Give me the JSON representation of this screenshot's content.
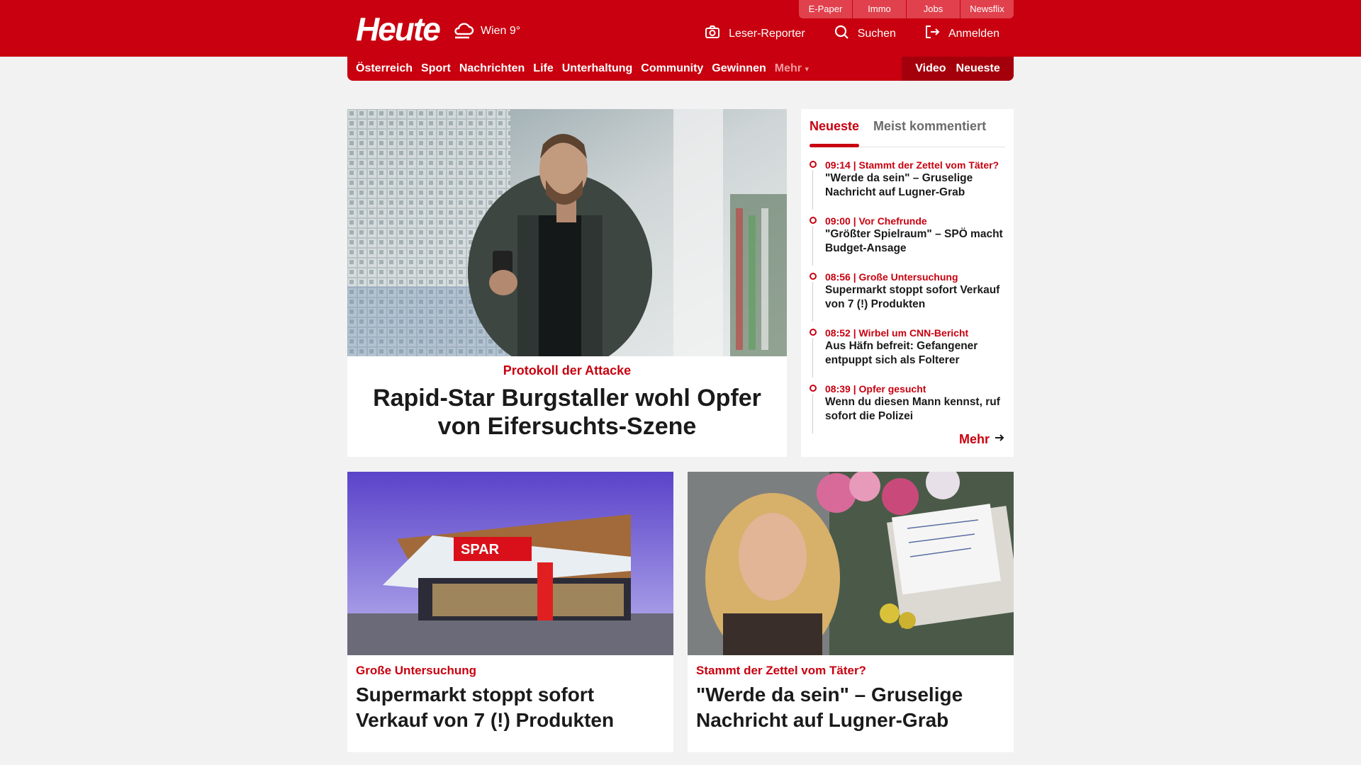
{
  "header": {
    "logo": "Heute",
    "weather": "Wien 9°",
    "service_links": [
      "E-Paper",
      "Immo",
      "Jobs",
      "Newsflix"
    ],
    "actions": {
      "reporter": "Leser-Reporter",
      "search": "Suchen",
      "login": "Anmelden"
    }
  },
  "nav": {
    "items": [
      "Österreich",
      "Sport",
      "Nachrichten",
      "Life",
      "Unterhaltung",
      "Community",
      "Gewinnen"
    ],
    "more": "Mehr",
    "video": "Video",
    "latest": "Neueste"
  },
  "hero": {
    "kicker": "Protokoll der Attacke",
    "title": "Rapid-Star Burgstaller wohl Opfer von Eifersuchts-Szene"
  },
  "sidebar": {
    "tabs": [
      "Neueste",
      "Meist kommentiert"
    ],
    "items": [
      {
        "meta": "09:14 | Stammt der Zettel vom Täter?",
        "title": "\"Werde da sein\" – Gruselige Nachricht auf Lugner-Grab"
      },
      {
        "meta": "09:00 | Vor Chefrunde",
        "title": "\"Größter Spielraum\" – SPÖ macht Budget-Ansage"
      },
      {
        "meta": "08:56 | Große Untersuchung",
        "title": "Supermarkt stoppt sofort Verkauf von 7 (!) Produkten"
      },
      {
        "meta": "08:52 | Wirbel um CNN-Bericht",
        "title": "Aus Häfn befreit: Gefangener entpuppt sich als Folterer"
      },
      {
        "meta": "08:39 | Opfer gesucht",
        "title": "Wenn du diesen Mann kennst, ruf sofort die Polizei"
      }
    ],
    "more": "Mehr"
  },
  "cards": [
    {
      "kicker": "Große Untersuchung",
      "title": "Supermarkt stoppt sofort Verkauf von 7 (!) Produkten",
      "sign": "SPAR"
    },
    {
      "kicker": "Stammt der Zettel vom Täter?",
      "title": "\"Werde da sein\" – Gruselige Nachricht auf Lugner-Grab"
    }
  ]
}
